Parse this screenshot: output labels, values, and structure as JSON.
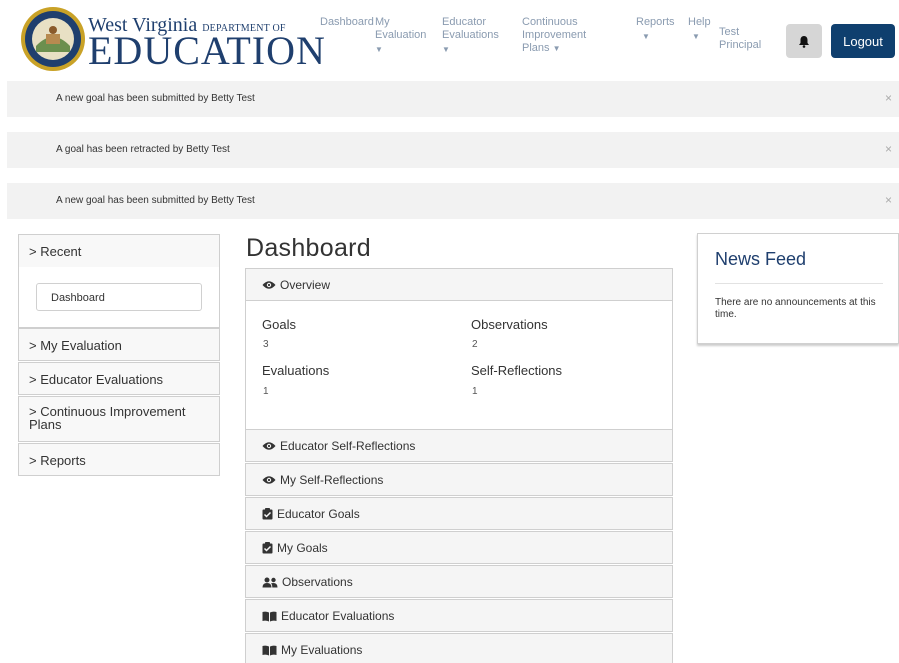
{
  "header": {
    "logo_line1": "West Virginia",
    "logo_dept": "DEPARTMENT OF",
    "logo_line2": "EDUCATION",
    "nav": [
      {
        "label": "Dashboard"
      },
      {
        "label": "My Evaluation"
      },
      {
        "label": "Educator Evaluations"
      },
      {
        "label": "Continuous Improvement Plans"
      },
      {
        "label": "Reports"
      },
      {
        "label": "Help"
      }
    ],
    "user_name": "Test Principal",
    "logout_label": "Logout",
    "bell_icon": "bell-icon",
    "colors": {
      "brand": "#1f3f6e",
      "logout_bg": "#0f3f6e",
      "nav_text": "#8a9bb0"
    }
  },
  "alerts": [
    {
      "text": "A new goal has been submitted by Betty Test",
      "close": "×"
    },
    {
      "text": "A goal has been retracted by Betty Test",
      "close": "×"
    },
    {
      "text": "A new goal has been submitted by Betty Test",
      "close": "×"
    }
  ],
  "sidebar": {
    "recent": "> Recent",
    "recent_items": [
      "Dashboard"
    ],
    "items": [
      {
        "label": "> My Evaluation"
      },
      {
        "label": "> Educator Evaluations"
      },
      {
        "label": "> Continuous Improvement Plans"
      },
      {
        "label": "> Reports"
      }
    ]
  },
  "main": {
    "title": "Dashboard",
    "overview": {
      "label": "Overview",
      "icon": "eye-icon",
      "stats": [
        {
          "label": "Goals",
          "value": "3"
        },
        {
          "label": "Observations",
          "value": "2"
        },
        {
          "label": "Evaluations",
          "value": "1"
        },
        {
          "label": "Self-Reflections",
          "value": "1"
        }
      ]
    },
    "panels": [
      {
        "label": "Educator Self-Reflections",
        "icon": "eye-icon"
      },
      {
        "label": "My Self-Reflections",
        "icon": "eye-icon"
      },
      {
        "label": "Educator Goals",
        "icon": "clipboard-check-icon"
      },
      {
        "label": "My Goals",
        "icon": "clipboard-check-icon"
      },
      {
        "label": "Observations",
        "icon": "users-icon"
      },
      {
        "label": "Educator Evaluations",
        "icon": "book-open-icon"
      },
      {
        "label": "My Evaluations",
        "icon": "book-open-icon"
      }
    ]
  },
  "news_feed": {
    "title": "News Feed",
    "text": "There are no announcements at this time."
  }
}
